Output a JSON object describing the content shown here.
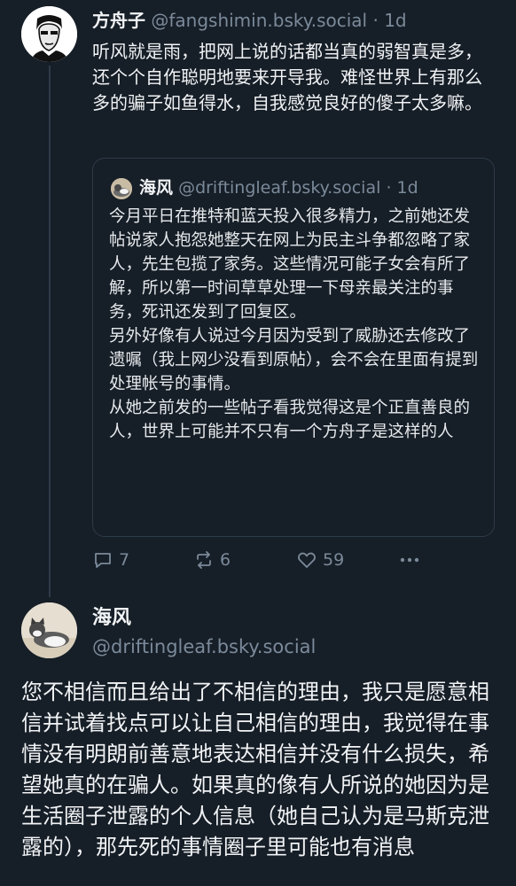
{
  "post1": {
    "display_name": "方舟子",
    "handle": "@fangshimin.bsky.social",
    "dot": "·",
    "time": "1d",
    "text": "听风就是雨，把网上说的话都当真的弱智真是多，还个个自作聪明地要来开导我。难怪世界上有那么多的骗子如鱼得水，自我感觉良好的傻子太多嘛。"
  },
  "quote": {
    "display_name": "海风",
    "handle": "@driftingleaf.bsky.social",
    "dot": "·",
    "time": "1d",
    "text_lines": [
      "今月平日在推特和蓝天投入很多精力，之前她还发帖说家人抱怨她整天在网上为民主斗争都忽略了家人，先生包揽了家务。这些情况可能子女会有所了解，所以第一时间草草处理一下母亲最关注的事务，死讯还发到了回复区。",
      "另外好像有人说过今月因为受到了威胁还去修改了遗嘱（我上网少没看到原帖），会不会在里面有提到处理帐号的事情。",
      "从她之前发的一些帖子看我觉得这是个正直善良的人，世界上可能并不只有一个方舟子是这样的人"
    ]
  },
  "actions": {
    "reply_icon": "reply-icon",
    "replies": "7",
    "repost_icon": "repost-icon",
    "reposts": "6",
    "like_icon": "heart-icon",
    "likes": "59",
    "more_icon": "more-icon"
  },
  "post2": {
    "display_name": "海风",
    "handle": "@driftingleaf.bsky.social",
    "text": "您不相信而且给出了不相信的理由，我只是愿意相信并试着找点可以让自己相信的理由，我觉得在事情没有明朗前善意地表达相信并没有什么损失，希望她真的在骗人。如果真的像有人所说的她因为是生活圈子泄露的个人信息（她自己认为是马斯克泄露的），那先死的事情圈子里可能也有消息"
  },
  "colors": {
    "background": "#161e27",
    "text": "#f1f3f5",
    "muted": "#7b8a9a",
    "border": "#2e3b4a"
  }
}
